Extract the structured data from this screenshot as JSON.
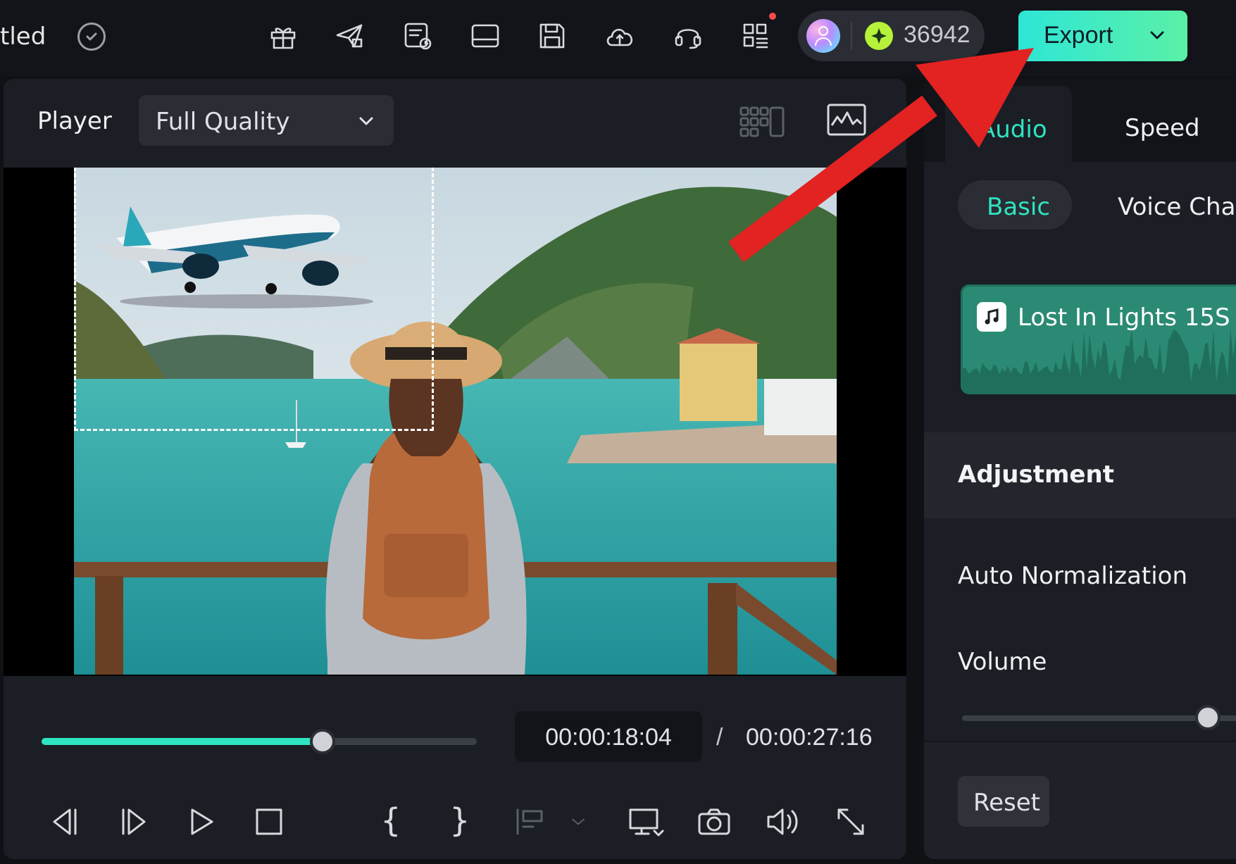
{
  "header": {
    "project_title": "tled",
    "credits": "36942",
    "export_label": "Export"
  },
  "icons": {
    "toolbar": [
      "gift-icon",
      "share-icon",
      "task-list-icon",
      "layout-icon",
      "save-icon",
      "cloud-upload-icon",
      "support-headset-icon",
      "apps-grid-icon"
    ]
  },
  "player": {
    "label": "Player",
    "quality": "Full Quality",
    "progress_fraction": 0.645,
    "time_current": "00:00:18:04",
    "time_separator": "/",
    "time_total": "00:00:27:16",
    "mark_in": "{",
    "mark_out": "}"
  },
  "right_panel": {
    "tabs": [
      "Audio",
      "Speed"
    ],
    "active_tab": "Audio",
    "subtabs": [
      "Basic",
      "Voice Char"
    ],
    "clip_name": "Lost In Lights 15S",
    "adjustment_title": "Adjustment",
    "auto_normalization": "Auto Normalization",
    "volume_label": "Volume",
    "volume_fraction": 0.83,
    "reset_label": "Reset"
  },
  "colors": {
    "accent": "#2fe4c2",
    "export_gradient_start": "#2ee6d6",
    "export_gradient_end": "#5af0a7",
    "annotation_arrow": "#e32222"
  }
}
